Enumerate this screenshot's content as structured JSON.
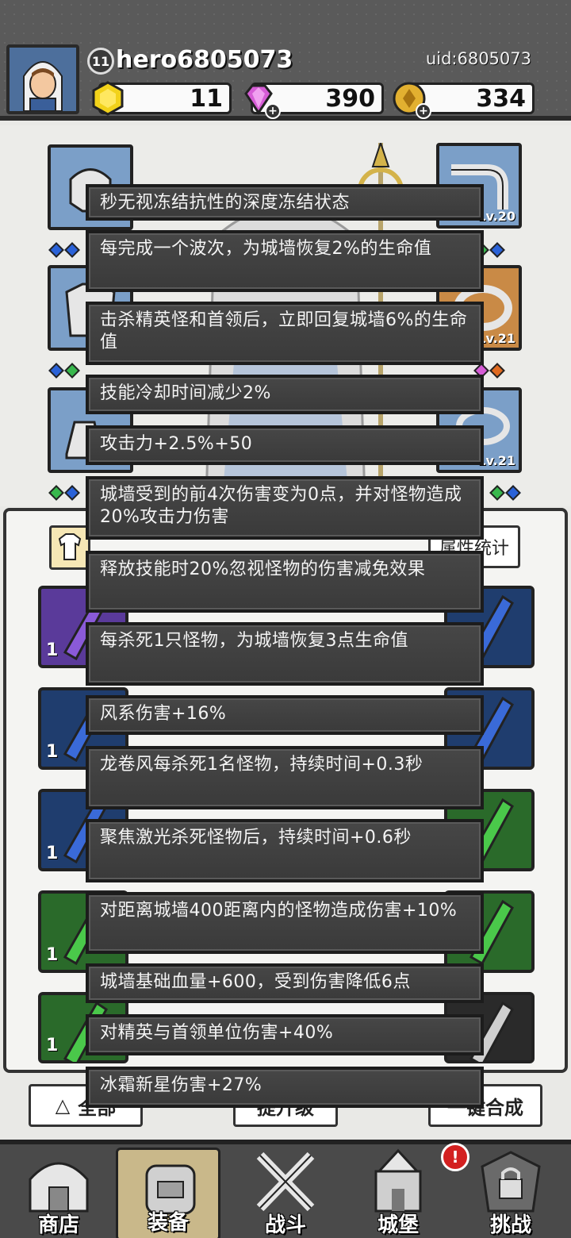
{
  "header": {
    "level": "11",
    "username": "hero6805073",
    "uid": "uid:6805073",
    "resources": [
      {
        "name": "gold-hex",
        "value": "11",
        "color": "#f2d21a"
      },
      {
        "name": "gem",
        "value": "390",
        "color": "#d65cd6"
      },
      {
        "name": "coin",
        "value": "334",
        "color": "#e2b030"
      }
    ]
  },
  "equip_slots": [
    {
      "icon": "helmet-icon",
      "level": ""
    },
    {
      "icon": "pipe-icon",
      "level": "Lv.20"
    },
    {
      "icon": "armor-icon",
      "level": ""
    },
    {
      "icon": "ring-icon",
      "level": "Lv.21"
    },
    {
      "icon": "boots-icon",
      "level": ""
    },
    {
      "icon": "ring2-icon",
      "level": "Lv.21"
    }
  ],
  "inventory": {
    "stat_button": "属性统计",
    "cards": [
      "1",
      "1",
      "1",
      "1",
      "1"
    ]
  },
  "actions": {
    "filter": "全部",
    "upgrade": "提升级",
    "merge": "一键合成"
  },
  "nav": [
    {
      "label": "商店",
      "icon": "shop-icon"
    },
    {
      "label": "装备",
      "icon": "backpack-icon"
    },
    {
      "label": "战斗",
      "icon": "swords-icon"
    },
    {
      "label": "城堡",
      "icon": "castle-icon"
    },
    {
      "label": "挑战",
      "icon": "locked-challenge-icon"
    }
  ],
  "notify": "!",
  "tooltips": [
    "秒无视冻结抗性的深度冻结状态",
    "每完成一个波次，为城墙恢复2%的生命值",
    "击杀精英怪和首领后，立即回复城墙6%的生命值",
    "技能冷却时间减少2%",
    "攻击力+2.5%+50",
    "城墙受到的前4次伤害变为0点，并对怪物造成20%攻击力伤害",
    "释放技能时20%忽视怪物的伤害减免效果",
    "每杀死1只怪物，为城墙恢复3点生命值",
    "风系伤害+16%",
    "龙卷风每杀死1名怪物，持续时间+0.3秒",
    "聚焦激光杀死怪物后，持续时间+0.6秒",
    "对距离城墙400距离内的怪物造成伤害+10%",
    "城墙基础血量+600，受到伤害降低6点",
    "对精英与首领单位伤害+40%",
    "冰霜新星伤害+27%"
  ]
}
